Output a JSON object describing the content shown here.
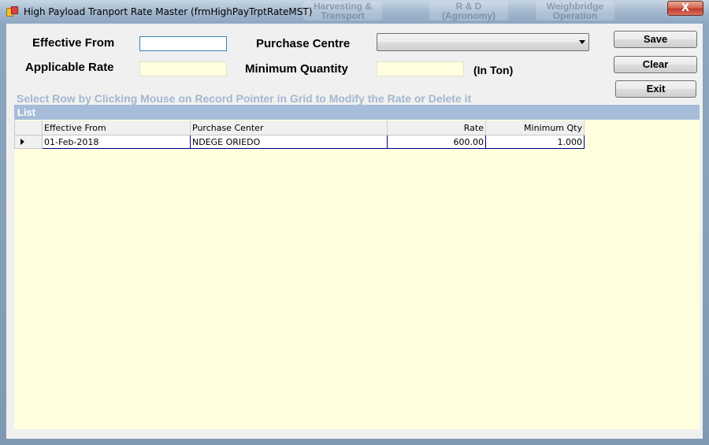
{
  "window": {
    "title": "High Payload Tranport Rate Master (frmHighPayTrptRateMST)",
    "close_label": "X"
  },
  "background_tabs": [
    "Harvesting & Transport",
    "R & D (Agronomy)",
    "Weighbridge Operation"
  ],
  "form": {
    "effective_from_label": "Effective From",
    "effective_from_value": "",
    "purchase_centre_label": "Purchase Centre",
    "purchase_centre_value": "",
    "applicable_rate_label": "Applicable Rate",
    "applicable_rate_value": "",
    "minimum_quantity_label": "Minimum Quantity",
    "minimum_quantity_value": "",
    "unit_label": "(In Ton)"
  },
  "buttons": {
    "save": "Save",
    "clear": "Clear",
    "exit": "Exit"
  },
  "hint": "Select Row by Clicking Mouse on Record Pointer in Grid to Modify the Rate or Delete it",
  "list": {
    "title": "List",
    "columns": [
      "Effective From",
      "Purchase Center",
      "Rate",
      "Minimum Qty"
    ],
    "rows": [
      {
        "effective_from": "01-Feb-2018",
        "purchase_center": "NDEGE ORIEDO",
        "rate": "600.00",
        "minimum_qty": "1.000"
      }
    ]
  }
}
